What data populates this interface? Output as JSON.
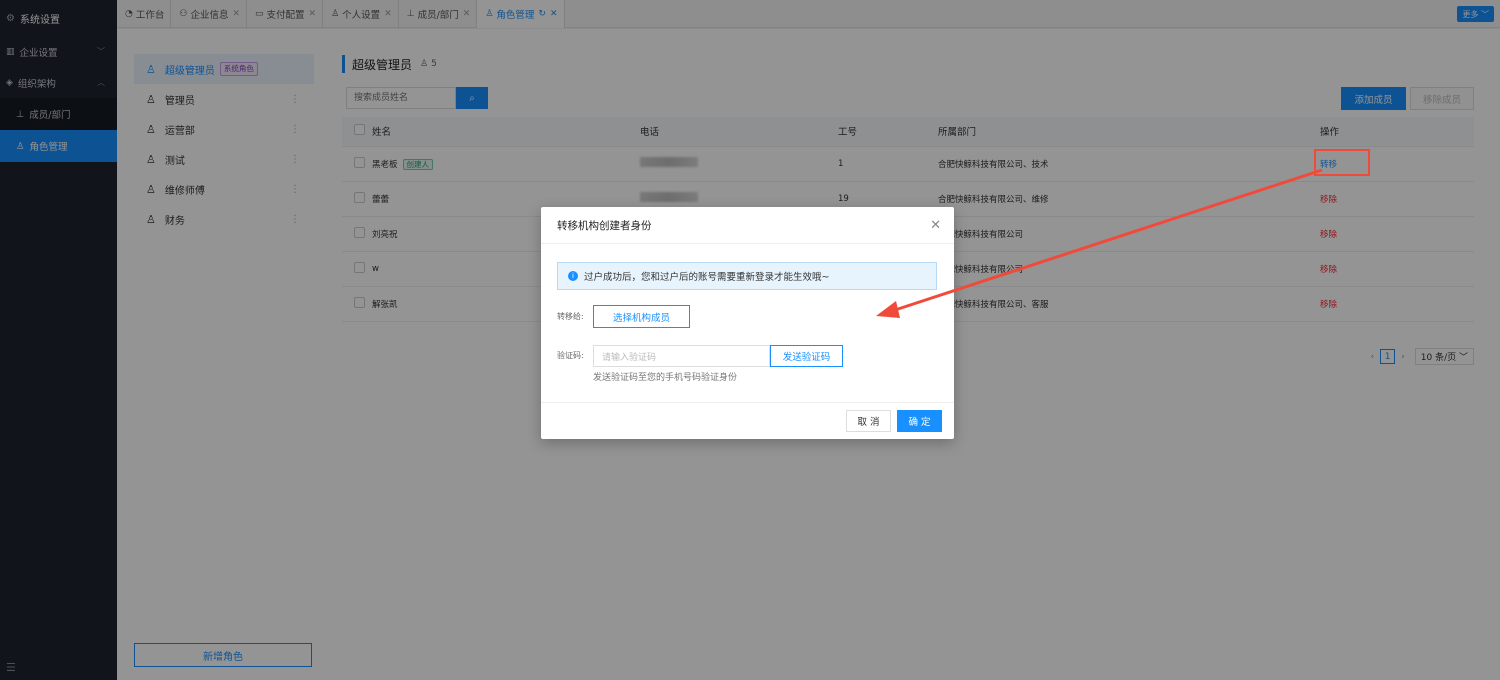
{
  "sidebar": {
    "title": "系统设置",
    "items": [
      {
        "label": "企业设置",
        "arrow": "﹀"
      },
      {
        "label": "组织架构",
        "arrow": "︿"
      }
    ],
    "subitems": [
      {
        "label": "成员/部门"
      },
      {
        "label": "角色管理"
      }
    ]
  },
  "tabs": [
    {
      "label": "工作台"
    },
    {
      "label": "企业信息"
    },
    {
      "label": "支付配置"
    },
    {
      "label": "个人设置"
    },
    {
      "label": "成员/部门"
    },
    {
      "label": "角色管理"
    }
  ],
  "more_label": "更多",
  "roles": [
    {
      "label": "超级管理员",
      "tag": "系统角色"
    },
    {
      "label": "管理员"
    },
    {
      "label": "运营部"
    },
    {
      "label": "测试"
    },
    {
      "label": "维修师傅"
    },
    {
      "label": "财务"
    }
  ],
  "add_role_label": "新增角色",
  "main": {
    "title": "超级管理员",
    "member_count": "5",
    "search_placeholder": "搜索成员姓名",
    "add_member_label": "添加成员",
    "remove_member_label": "移除成员"
  },
  "table": {
    "headers": [
      "姓名",
      "电话",
      "工号",
      "所属部门",
      "操作"
    ],
    "rows": [
      {
        "name": "黑老板",
        "tag": "创建人",
        "no": "1",
        "dept": "合肥快鲸科技有限公司、技术",
        "op": "转移"
      },
      {
        "name": "蕾蕾",
        "tag": "",
        "no": "19",
        "dept": "合肥快鲸科技有限公司、维修",
        "op": "移除"
      },
      {
        "name": "刘亮祝",
        "tag": "",
        "no": "",
        "dept": "合肥快鲸科技有限公司",
        "op": "移除"
      },
      {
        "name": "w",
        "tag": "",
        "no": "",
        "dept": "合肥快鲸科技有限公司",
        "op": "移除"
      },
      {
        "name": "解张凯",
        "tag": "",
        "no": "",
        "dept": "合肥快鲸科技有限公司、客服",
        "op": "移除"
      }
    ]
  },
  "pager": {
    "page": "1",
    "size": "10 条/页"
  },
  "modal": {
    "title": "转移机构创建者身份",
    "notice": "过户成功后，您和过户后的账号需要重新登录才能生效哦~",
    "transfer_label": "转移给:",
    "select_member": "选择机构成员",
    "code_label": "验证码:",
    "code_placeholder": "请输入验证码",
    "send_code": "发送验证码",
    "hint": "发送验证码至您的手机号码验证身份",
    "cancel": "取 消",
    "ok": "确 定"
  },
  "colors": {
    "primary": "#1890ff",
    "danger": "#f5222d",
    "sidebar": "#1f2430",
    "annotation": "#f04b3a"
  }
}
